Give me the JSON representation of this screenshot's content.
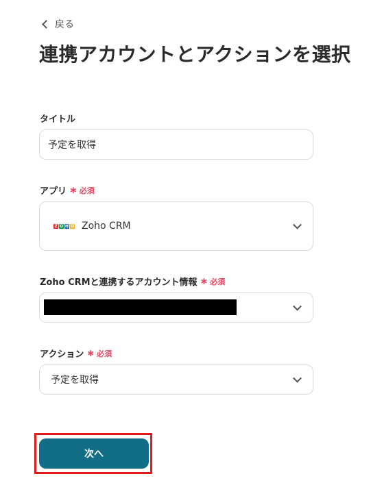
{
  "nav": {
    "back_label": "戻る"
  },
  "page": {
    "title": "連携アカウントとアクションを選択"
  },
  "form": {
    "title_field": {
      "label": "タイトル",
      "value": "予定を取得"
    },
    "app_field": {
      "label": "アプリ",
      "required_label": "必須",
      "value": "Zoho CRM",
      "logo_icon": "zoho-logo-icon"
    },
    "account_field": {
      "label": "Zoho CRMと連携するアカウント情報",
      "required_label": "必須"
    },
    "action_field": {
      "label": "アクション",
      "required_label": "必須",
      "value": "予定を取得"
    }
  },
  "footer": {
    "next_label": "次へ"
  },
  "colors": {
    "primary": "#126d87",
    "required": "#e8425f",
    "highlight": "#e31b1b"
  }
}
